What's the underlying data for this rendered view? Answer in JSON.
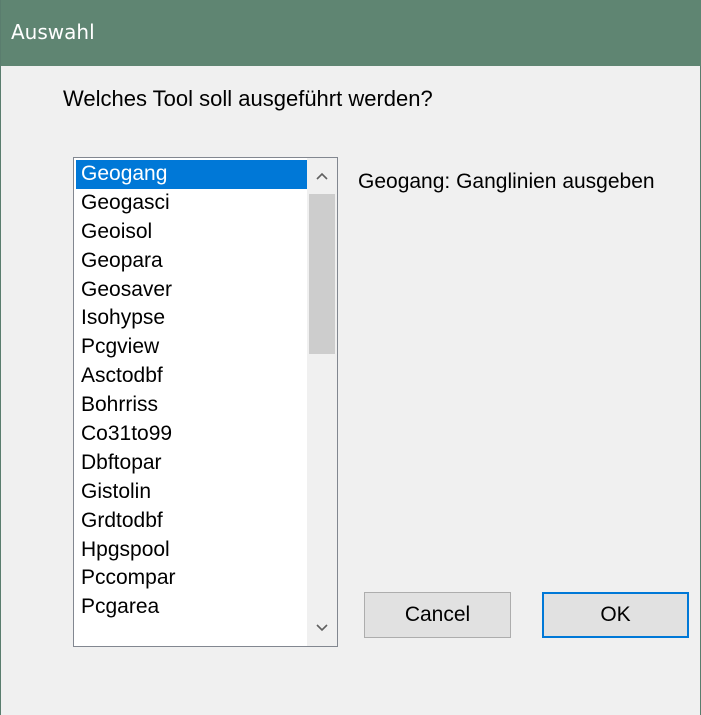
{
  "window": {
    "title": "Auswahl"
  },
  "prompt": "Welches Tool soll ausgeführt werden?",
  "list": {
    "selected_index": 0,
    "items": [
      "Geogang",
      "Geogasci",
      "Geoisol",
      "Geopara",
      "Geosaver",
      "Isohypse",
      "Pcgview",
      "Asctodbf",
      "Bohrriss",
      "Co31to99",
      "Dbftopar",
      "Gistolin",
      "Grdtodbf",
      "Hpgspool",
      "Pccompar",
      "Pcgarea"
    ],
    "scroll_icons": {
      "up": "chevron-up-icon",
      "down": "chevron-down-icon"
    }
  },
  "description": "Geogang: Ganglinien ausgeben",
  "buttons": {
    "cancel": "Cancel",
    "ok": "OK"
  },
  "colors": {
    "titlebar": "#5f8572",
    "selection": "#0078d7",
    "background": "#f0f0f0"
  }
}
